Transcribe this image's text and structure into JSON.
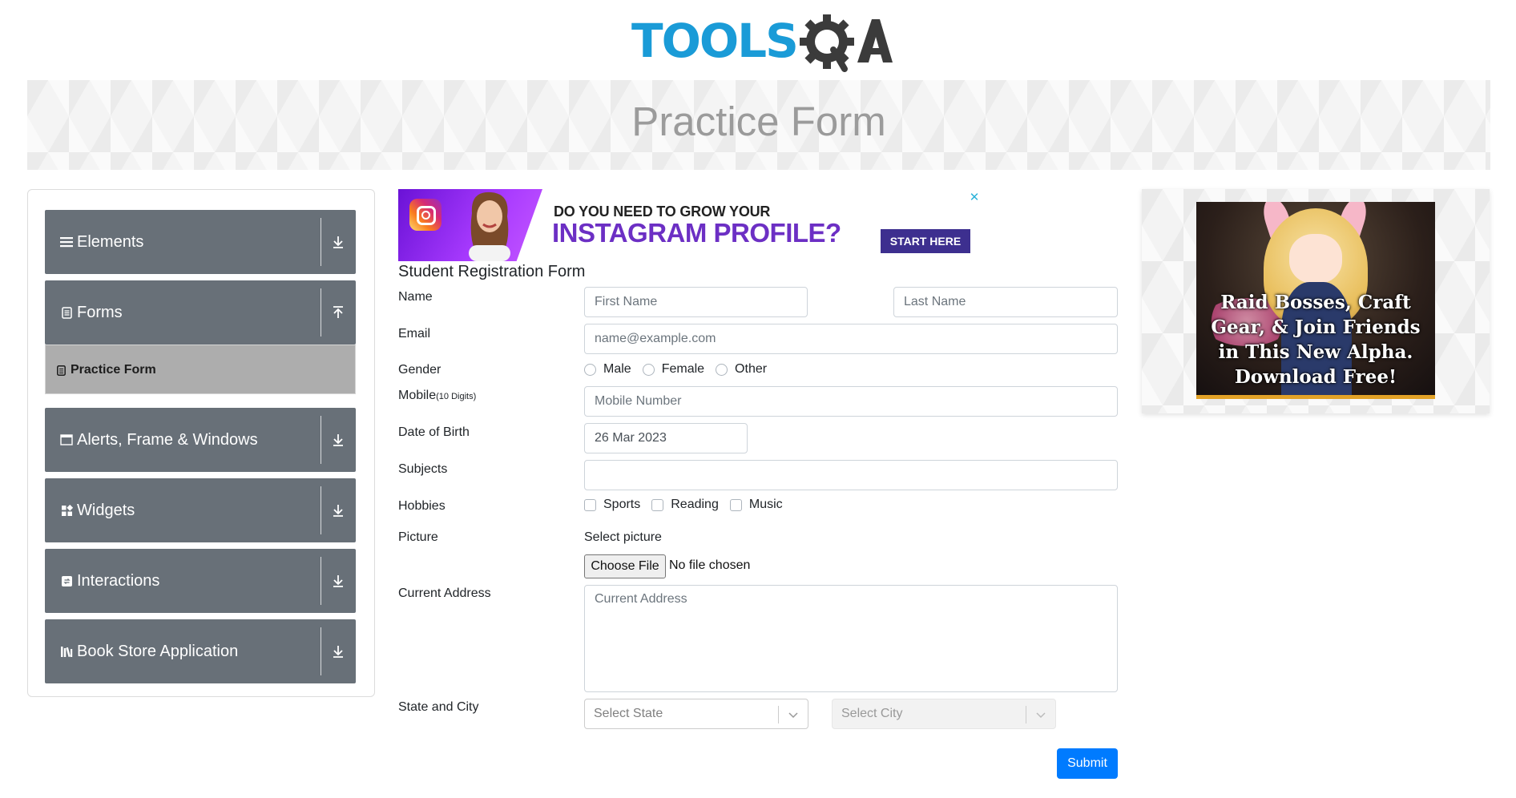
{
  "logo": {
    "text_tools": "TOOLS",
    "text_qa": "QA"
  },
  "page_title": "Practice Form",
  "sidebar": {
    "groups": [
      {
        "label": "Elements",
        "icon": "list-icon",
        "state": "collapsed"
      },
      {
        "label": "Forms",
        "icon": "document-icon",
        "state": "expanded"
      },
      {
        "label": "Alerts, Frame & Windows",
        "icon": "window-icon",
        "state": "collapsed"
      },
      {
        "label": "Widgets",
        "icon": "widgets-icon",
        "state": "collapsed"
      },
      {
        "label": "Interactions",
        "icon": "interactions-icon",
        "state": "collapsed"
      },
      {
        "label": "Book Store Application",
        "icon": "books-icon",
        "state": "collapsed"
      }
    ],
    "forms_subitems": [
      {
        "label": "Practice Form",
        "active": true
      }
    ]
  },
  "ad_top": {
    "line1": "DO YOU NEED TO GROW YOUR",
    "line2": "INSTAGRAM PROFILE?",
    "cta": "START HERE",
    "close": "✕"
  },
  "form": {
    "title": "Student Registration Form",
    "name_label": "Name",
    "first_name_placeholder": "First Name",
    "last_name_placeholder": "Last Name",
    "email_label": "Email",
    "email_placeholder": "name@example.com",
    "gender_label": "Gender",
    "gender_options": [
      "Male",
      "Female",
      "Other"
    ],
    "mobile_label": "Mobile",
    "mobile_hint": "(10 Digits)",
    "mobile_placeholder": "Mobile Number",
    "dob_label": "Date of Birth",
    "dob_value": "26 Mar 2023",
    "subjects_label": "Subjects",
    "hobbies_label": "Hobbies",
    "hobbies_options": [
      "Sports",
      "Reading",
      "Music"
    ],
    "picture_label": "Picture",
    "picture_note": "Select picture",
    "file_button": "Choose File",
    "file_status": "No file chosen",
    "address_label": "Current Address",
    "address_placeholder": "Current Address",
    "state_city_label": "State and City",
    "state_placeholder": "Select State",
    "city_placeholder": "Select City",
    "submit_label": "Submit"
  },
  "ad_right": {
    "text": "Raid Bosses, Craft Gear, & Join Friends in This New Alpha. Download Free!"
  },
  "colors": {
    "sidebar_group_bg": "#687078",
    "sidebar_active_bg": "#adadad",
    "logo_blue": "#1a9bd7",
    "logo_dark": "#3b3b3b",
    "submit_bg": "#007bff",
    "ad_cta_bg": "#3d2f8f",
    "ad_headline": "#6c2fc4"
  }
}
